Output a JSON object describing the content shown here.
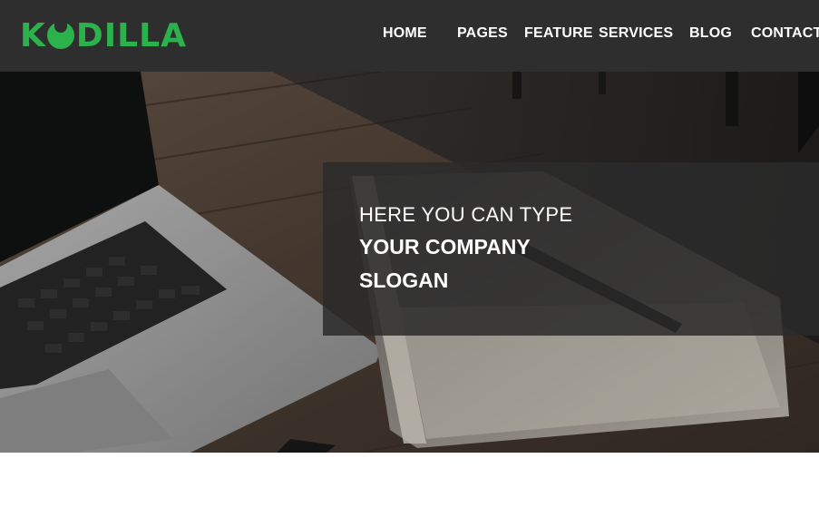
{
  "brand": {
    "logo_first": "K",
    "logo_rest": "DILLA",
    "logo_text": "KODILLA",
    "accent_color": "#2bb24c"
  },
  "nav": {
    "items": [
      {
        "label": "HOME"
      },
      {
        "label": "PAGES"
      },
      {
        "label": "FEATURE"
      },
      {
        "label": "SERVICES"
      },
      {
        "label": "BLOG"
      },
      {
        "label": "CONTACT"
      }
    ]
  },
  "hero": {
    "slogan_line1": "HERE YOU CAN TYPE",
    "slogan_line2": "YOUR COMPANY",
    "slogan_line3": "SLOGAN"
  },
  "colors": {
    "header_bg": "#2e2e2e",
    "slogan_box_bg": "#2b2b2b"
  }
}
